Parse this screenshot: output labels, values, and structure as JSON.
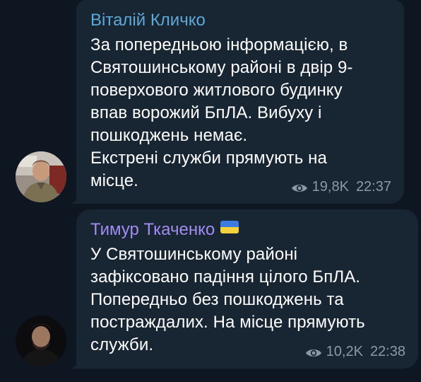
{
  "messages": [
    {
      "sender": "Віталій Кличко",
      "sender_color": "#5ea9d9",
      "text_lines": [
        "За попередньою інформацією, в",
        "Святошинському районі в двір 9-",
        "поверхового житлового будинку",
        "впав ворожий БпЛА. Вибуху і",
        "пошкоджень немає.",
        "Екстрені служби прямують на",
        "місце."
      ],
      "views": "19,8K",
      "time": "22:37",
      "icons": [
        "eye-icon"
      ]
    },
    {
      "sender": "Тимур Ткаченко",
      "sender_color": "#a38cf1",
      "sender_badge": "ukraine-flag-icon",
      "text_lines": [
        "У Святошинському районі",
        "зафіксовано падіння цілого БпЛА.",
        "Попередньо без пошкоджень та",
        "постраждалих. На місце прямують",
        "служби."
      ],
      "views": "10,2K",
      "time": "22:38",
      "icons": [
        "eye-icon"
      ]
    }
  ],
  "colors": {
    "background": "#0e1621",
    "bubble": "#182533",
    "text": "#ffffff",
    "meta": "#8a99a8"
  }
}
